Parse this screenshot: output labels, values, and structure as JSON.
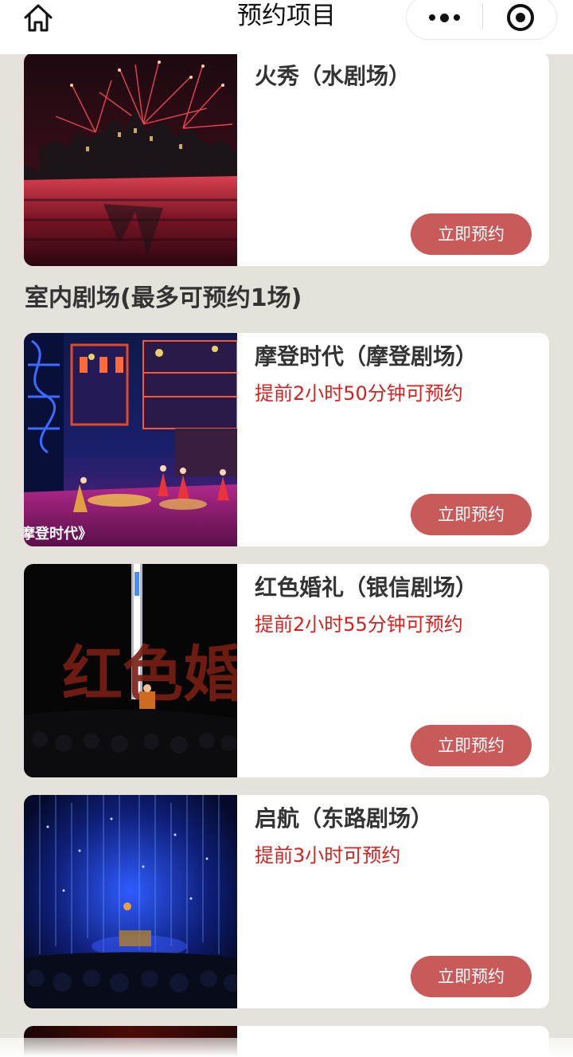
{
  "header": {
    "title": "预约项目",
    "home_icon": "home-icon",
    "more_icon": "more-dots-icon",
    "close_icon": "miniprogram-close-icon"
  },
  "section": {
    "title": "室内剧场(最多可预约1场)"
  },
  "shows": [
    {
      "name": "火秀（水剧场）",
      "note": "",
      "button": "立即预约",
      "image": "fireworks-over-castle"
    },
    {
      "name": "摩登时代（摩登剧场）",
      "note": "提前2小时50分钟可预约",
      "button": "立即预约",
      "image": "modern-times-stage",
      "image_caption": "摩登时代》"
    },
    {
      "name": "红色婚礼（银信剧场）",
      "note": "提前2小时55分钟可预约",
      "button": "立即预约",
      "image": "red-wedding-stage",
      "image_caption": "红色婚礼"
    },
    {
      "name": "启航（东路剧场）",
      "note": "提前3小时可预约",
      "button": "立即预约",
      "image": "sailing-blue-stage"
    }
  ],
  "colors": {
    "background": "#e4e2da",
    "button": "#c85a5a",
    "note_red": "#d5211f",
    "title_text": "#333333"
  }
}
